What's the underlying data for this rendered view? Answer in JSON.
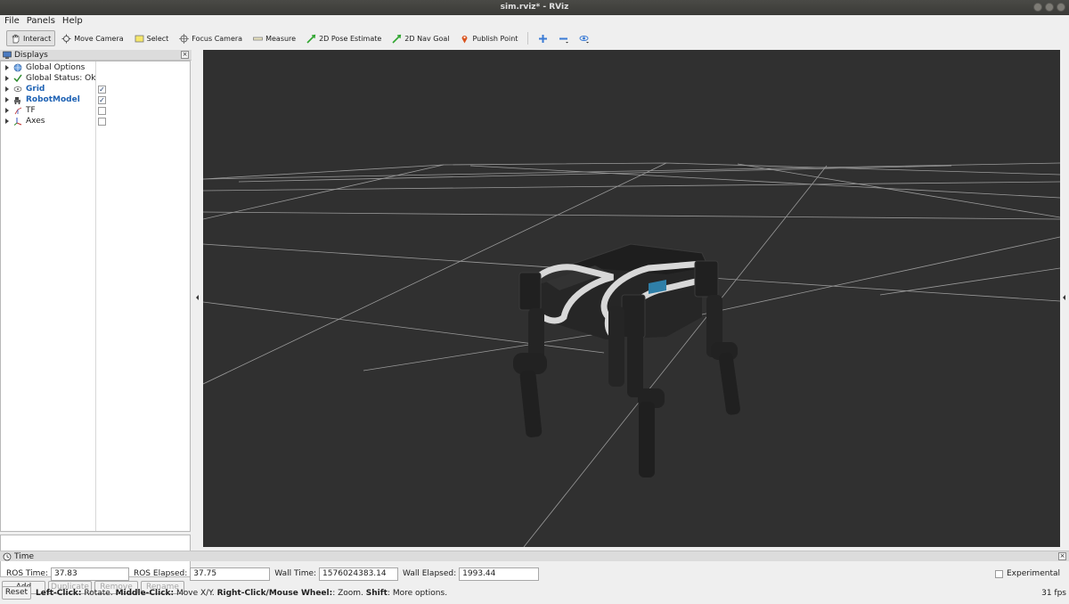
{
  "window": {
    "title": "sim.rviz* - RViz"
  },
  "menu": {
    "file": "File",
    "panels": "Panels",
    "help": "Help"
  },
  "toolbar": {
    "interact": "Interact",
    "move_camera": "Move Camera",
    "select": "Select",
    "focus_camera": "Focus Camera",
    "measure": "Measure",
    "pose_estimate": "2D Pose Estimate",
    "nav_goal": "2D Nav Goal",
    "publish_point": "Publish Point"
  },
  "displays": {
    "title": "Displays",
    "items": [
      {
        "label": "Global Options",
        "icon": "globe-icon",
        "checkbox": null,
        "highlight": false
      },
      {
        "label": "Global Status: Ok",
        "icon": "check-icon",
        "checkbox": null,
        "highlight": false
      },
      {
        "label": "Grid",
        "icon": "grid-icon",
        "checkbox": true,
        "highlight": true
      },
      {
        "label": "RobotModel",
        "icon": "robot-icon",
        "checkbox": true,
        "highlight": true
      },
      {
        "label": "TF",
        "icon": "tf-icon",
        "checkbox": false,
        "highlight": false
      },
      {
        "label": "Axes",
        "icon": "axes-icon",
        "checkbox": false,
        "highlight": false
      }
    ],
    "buttons": {
      "add": "Add",
      "duplicate": "Duplicate",
      "remove": "Remove",
      "rename": "Rename"
    }
  },
  "time": {
    "title": "Time",
    "ros_time_label": "ROS Time:",
    "ros_time": "37.83",
    "ros_elapsed_label": "ROS Elapsed:",
    "ros_elapsed": "37.75",
    "wall_time_label": "Wall Time:",
    "wall_time": "1576024383.14",
    "wall_elapsed_label": "Wall Elapsed:",
    "wall_elapsed": "1993.44",
    "experimental": "Experimental"
  },
  "status": {
    "reset": "Reset",
    "left_click": "Left-Click:",
    "left_click_desc": " Rotate. ",
    "middle_click": "Middle-Click:",
    "middle_click_desc": " Move X/Y. ",
    "right_click": "Right-Click/Mouse Wheel:",
    "right_click_desc": ": Zoom. ",
    "shift": "Shift",
    "shift_desc": ": More options.",
    "fps": "31 fps"
  },
  "colors": {
    "viewport_bg": "#303030",
    "grid": "#a0a0a0",
    "highlight": "#1e62b4"
  }
}
